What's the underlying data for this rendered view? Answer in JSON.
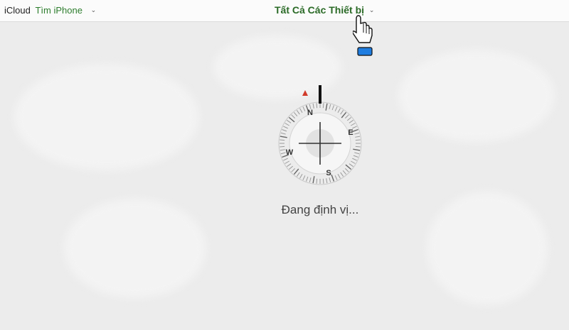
{
  "topbar": {
    "brand": "iCloud",
    "app_name": "Tìm iPhone",
    "app_menu_icon": "chevron-down-icon",
    "devices_label": "Tất Cả Các Thiết bị",
    "devices_menu_icon": "chevron-down-icon"
  },
  "compass": {
    "north": "N",
    "east": "E",
    "south": "S",
    "west": "W",
    "icon": "compass-icon"
  },
  "status": {
    "text": "Đang định vị..."
  },
  "cursor": {
    "icon": "hand-pointer-icon"
  },
  "colors": {
    "app_green": "#2d7d2d",
    "devices_green": "#2a6a26",
    "north_marker": "#d13a2a",
    "cursor_accent": "#1f7de0"
  }
}
